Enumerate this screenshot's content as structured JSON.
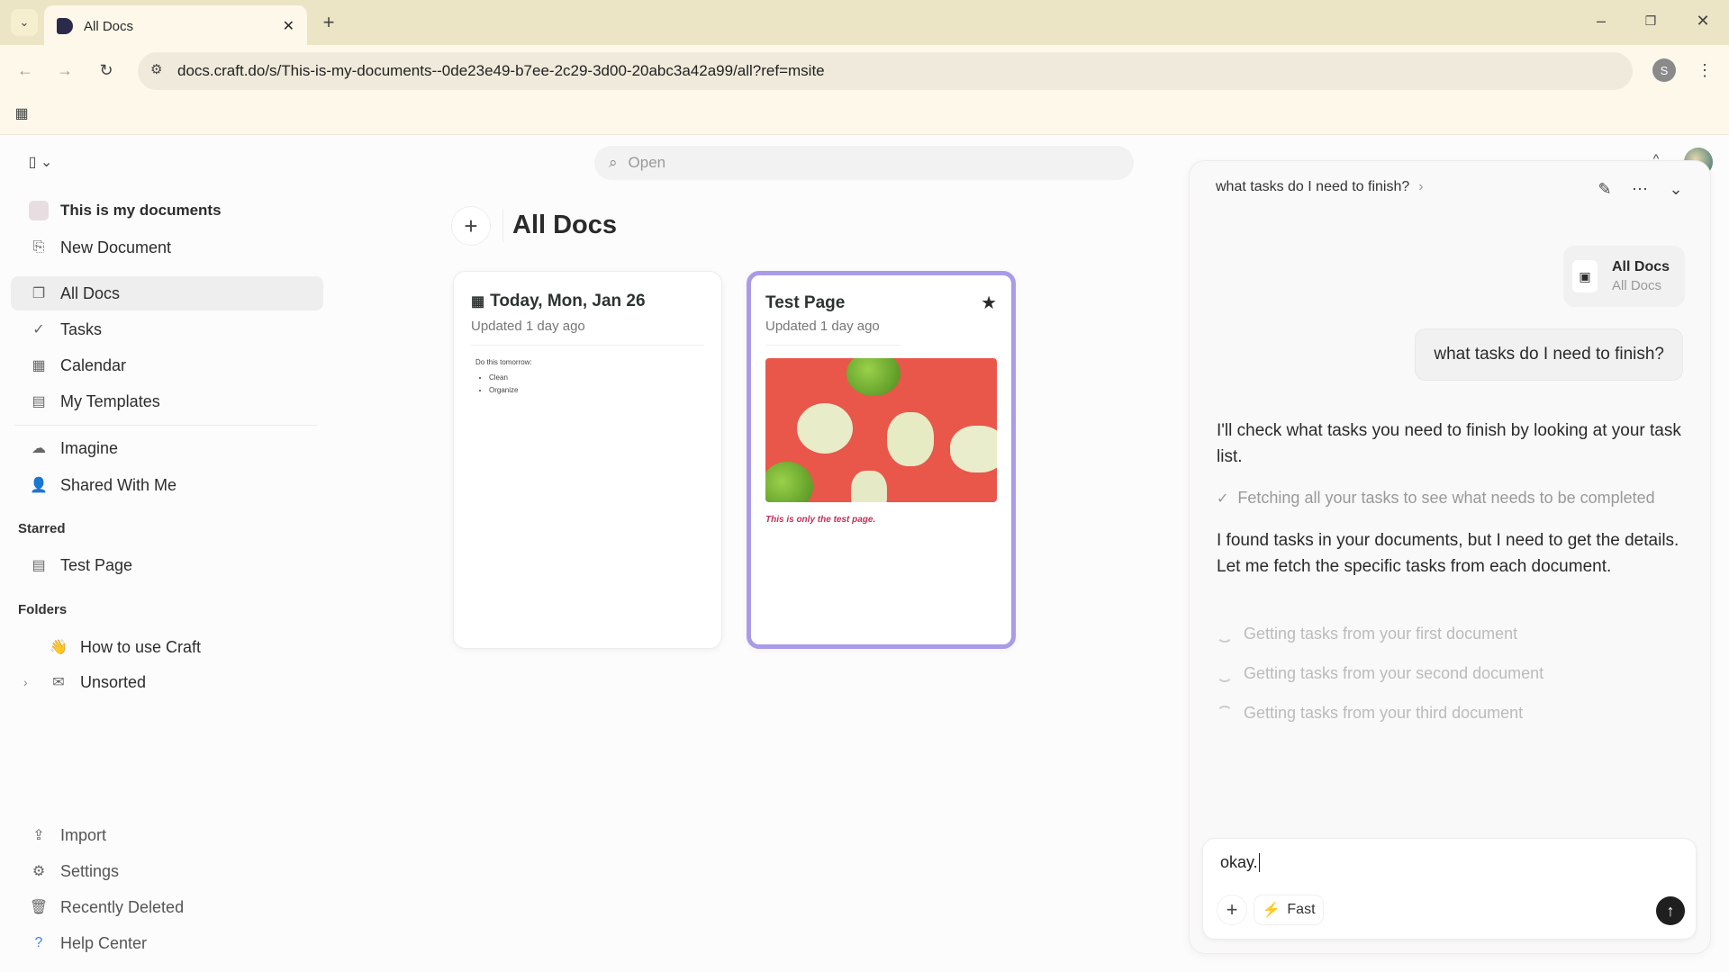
{
  "browser": {
    "tab_title": "All Docs",
    "url": "docs.craft.do/s/This-is-my-documents--0de23e49-b7ee-2c29-3d00-20abc3a42a99/all?ref=msite",
    "profile_initial": "S"
  },
  "sidebar": {
    "space_name": "This is my documents",
    "new_document": "New Document",
    "nav": [
      {
        "label": "All Docs",
        "icon": "docs-icon"
      },
      {
        "label": "Tasks",
        "icon": "check-circle-icon"
      },
      {
        "label": "Calendar",
        "icon": "calendar-icon"
      },
      {
        "label": "My Templates",
        "icon": "template-icon"
      }
    ],
    "nav2": [
      {
        "label": "Imagine",
        "icon": "cloud-icon"
      },
      {
        "label": "Shared With Me",
        "icon": "shared-icon"
      }
    ],
    "starred_heading": "Starred",
    "starred": [
      "Test Page"
    ],
    "folders_heading": "Folders",
    "folders": [
      "How to use Craft",
      "Unsorted"
    ],
    "bottom": [
      "Import",
      "Settings",
      "Recently Deleted",
      "Help Center"
    ]
  },
  "search": {
    "placeholder": "Open"
  },
  "main": {
    "title": "All Docs",
    "cards": [
      {
        "title": "Today, Mon, Jan 26",
        "updated": "Updated 1 day ago",
        "preview_heading": "Do this tomorrow:",
        "preview_items": [
          "Clean",
          "Organize"
        ]
      },
      {
        "title": "Test Page",
        "updated": "Updated 1 day ago",
        "caption": "This is only the test page.",
        "starred": true
      }
    ]
  },
  "chat": {
    "title": "what tasks do I need to finish?",
    "context_chip": {
      "title": "All Docs",
      "subtitle": "All Docs"
    },
    "user_message": "what tasks do I need to finish?",
    "reply1": "I'll check what tasks you need to finish by looking at your task list.",
    "tool_done": "Fetching all your tasks to see what needs to be completed",
    "reply2": "I found tasks in your documents, but I need to get the details. Let me fetch the specific tasks from each document.",
    "pending": [
      "Getting tasks from your first document",
      "Getting tasks from your second document",
      "Getting tasks from your third document"
    ],
    "input_value": "okay.",
    "mode_label": "Fast"
  },
  "colors": {
    "accent": "#a99be8",
    "caption": "#c0315a",
    "send": "#1f1f1f"
  }
}
